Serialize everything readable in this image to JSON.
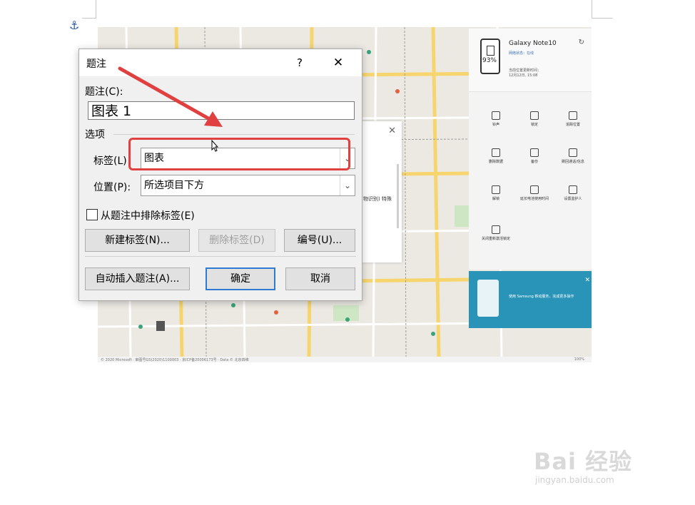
{
  "dialog": {
    "title": "题注",
    "help_label": "?",
    "close_label": "✕",
    "caption_label": "题注(C):",
    "caption_value": "图表 1",
    "options_group_label": "选项",
    "label_field_label": "标签(L)",
    "label_value": "图表",
    "position_field_label": "位置(P):",
    "position_value": "所选项目下方",
    "exclude_label_checkbox": "从题注中排除标签(E)",
    "exclude_label_checked": false,
    "new_label_button": "新建标签(N)...",
    "delete_label_button": "删除标签(D)",
    "numbering_button": "编号(U)...",
    "autocaption_button": "自动插入题注(A)...",
    "ok_button": "确定",
    "cancel_button": "取消"
  },
  "embedded_screenshot": {
    "phone_panel": {
      "device_name": "Galaxy Note10",
      "status": "网络状态：在线",
      "battery_percent": "93%",
      "last_location": "当前位置更新时间：",
      "last_location_time": "12月12日, 15:08",
      "actions": [
        "铃声",
        "锁定",
        "追踪位置",
        "删除数据",
        "备份",
        "刷回通话/信息",
        "解锁",
        "延长电池使用时间",
        "设置监护人",
        "关闭重新激活锁定"
      ]
    },
    "popup_text": "物识别) 特殊",
    "banner_text": "使用 Samsung 移动服务，完成更多操作",
    "map_footer_left": "© 2020 Microsoft · 审图号GS(2020)1100003 · 京ICP备20006173号 · Data © 北京四维",
    "zoom_label": "100%"
  },
  "annotation": {
    "highlight_color": "#e04040"
  },
  "watermark": {
    "brand": "Bai 经验",
    "url": "jingyan.baidu.com"
  }
}
